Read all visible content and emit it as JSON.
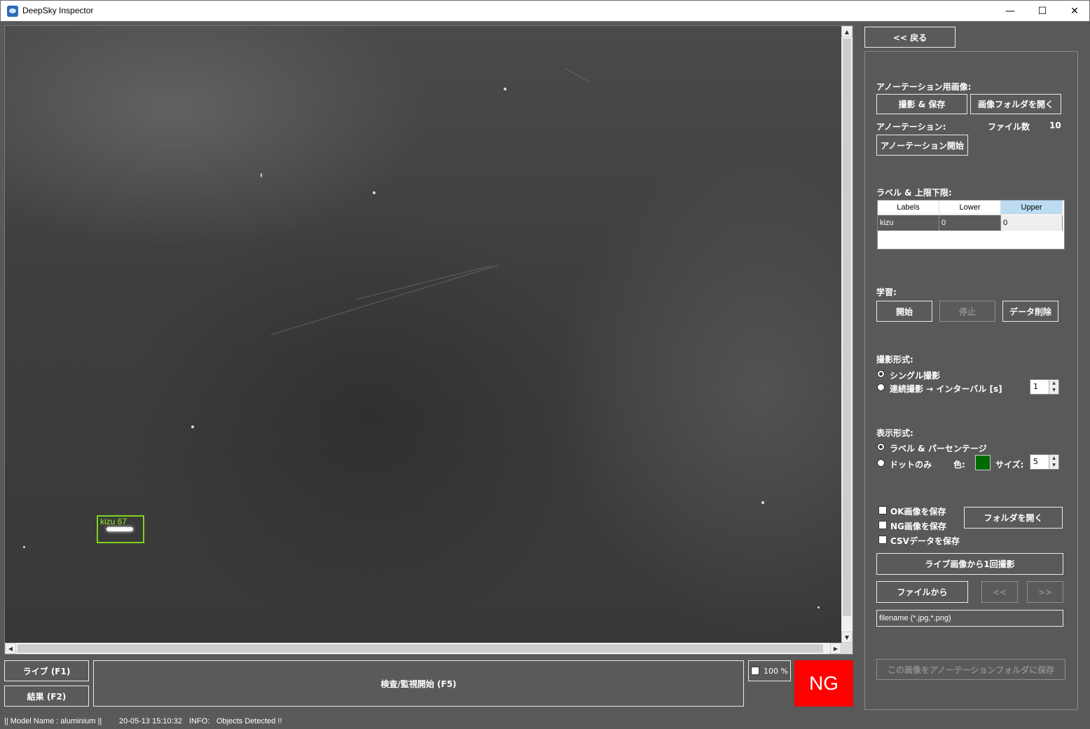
{
  "window": {
    "title": "DeepSky Inspector",
    "minimize": "—",
    "maximize": "☐",
    "close": "✕"
  },
  "detection": {
    "label": "kizu 67"
  },
  "viewer": {
    "up_arrow": "▲",
    "down_arrow": "▼",
    "left_arrow": "◀",
    "right_arrow": "▶"
  },
  "bottom": {
    "live_button": "ライブ (F1)",
    "result_button": "結果 (F2)",
    "inspect_button": "検査/監視開始 (F5)",
    "zoom_label": "100 %",
    "verdict": "NG"
  },
  "status": {
    "model": "|| Model Name : aluminium ||",
    "timestamp": "20-05-13 15:10:32",
    "info_label": "INFO:",
    "info_message": "Objects Detected !!"
  },
  "panel": {
    "back_button": "<< 戻る",
    "annotation_images_label": "アノーテーション用画像:",
    "capture_save_button": "撮影 & 保存",
    "open_image_folder_button": "画像フォルダを開く",
    "annotation_label": "アノーテーション:",
    "file_count_label": "ファイル数",
    "file_count_value": "10",
    "annotation_start_button": "アノーテーション開始",
    "labels_limits_label": "ラベル & 上限下限:",
    "grid": {
      "headers": [
        "Labels",
        "Lower",
        "Upper"
      ],
      "rows": [
        [
          "kizu",
          "0",
          "0"
        ]
      ]
    },
    "training_label": "学習:",
    "train_start_button": "開始",
    "train_stop_button": "停止",
    "data_delete_button": "データ削除",
    "capture_mode_label": "撮影形式:",
    "single_capture": "シングル撮影",
    "continuous_capture": "連続撮影 → インターバル [s]",
    "interval_value": "1",
    "display_mode_label": "表示形式:",
    "label_percentage": "ラベル & パーセンテージ",
    "dots_only": "ドットのみ",
    "color_label": "色:",
    "size_label": "サイズ:",
    "size_value": "5",
    "swatch_color": "#006b00",
    "save_ok": "OK画像を保存",
    "save_ng": "NG画像を保存",
    "save_csv": "CSVデータを保存",
    "open_folder_button": "フォルダを開く",
    "capture_from_live_button": "ライブ画像から1回撮影",
    "from_file_button": "ファイルから",
    "prev_button": "<<",
    "next_button": ">>",
    "filename_placeholder": "filename (*.jpg,*.png)",
    "save_to_annotation_button": "この画像をアノーテーションフォルダに保存"
  }
}
